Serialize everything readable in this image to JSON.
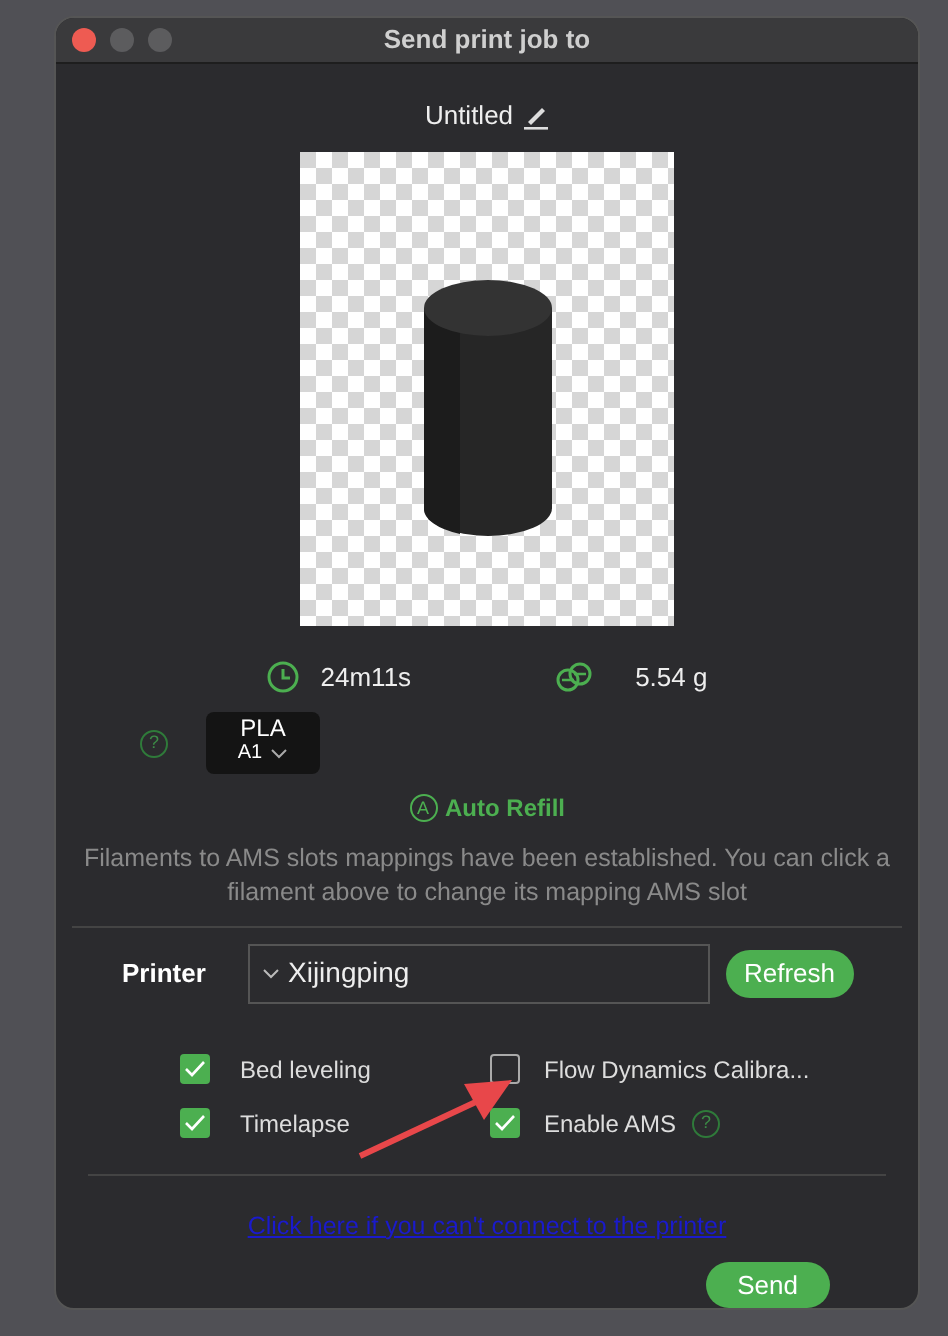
{
  "window": {
    "title": "Send print job to"
  },
  "job_name": "Untitled",
  "stats": {
    "time": "24m11s",
    "weight": "5.54 g"
  },
  "filament": {
    "help_icon": "?",
    "type": "PLA",
    "slot": "A1"
  },
  "auto_refill": {
    "icon": "A",
    "label": "Auto Refill"
  },
  "mapping_note": "Filaments to AMS slots mappings have been established. You can click a filament above to change its mapping AMS slot",
  "printer": {
    "label": "Printer",
    "value": "Xijingping",
    "refresh": "Refresh"
  },
  "options": [
    {
      "label": "Bed leveling",
      "checked": true
    },
    {
      "label": "Flow Dynamics Calibra...",
      "checked": false
    },
    {
      "label": "Timelapse",
      "checked": true
    },
    {
      "label": "Enable AMS",
      "checked": true,
      "help_icon": "?"
    }
  ],
  "link": "Click here if you can't connect to the printer",
  "send": "Send"
}
